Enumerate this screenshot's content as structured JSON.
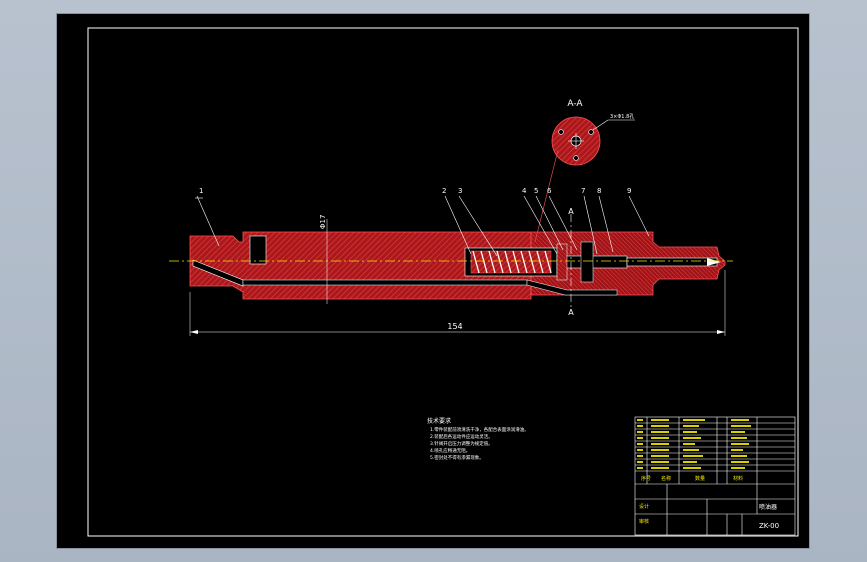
{
  "section": {
    "title": "A-A",
    "hole_note": "3×Φ1.8孔"
  },
  "callouts": [
    "1",
    "2",
    "3",
    "4",
    "5",
    "6",
    "7",
    "8",
    "9"
  ],
  "cut_marks": {
    "top": "A",
    "bottom": "A"
  },
  "dimensions": {
    "diameter": "Φ17",
    "length": "154"
  },
  "notes": {
    "heading": "技术要求",
    "lines": [
      "1.零件装配前须清洗干净，各配合表面涂润滑油。",
      "2.装配后各运动件应运动灵活。",
      "3.针阀开启压力调整为规定值。",
      "4.喷孔应畅通无阻。",
      "5.密封处不得有渗漏现象。"
    ]
  },
  "title_block": {
    "headers": [
      "序号",
      "名称",
      "数量",
      "材料"
    ],
    "part_name": "喷油器",
    "drawing_no": "ZK-00",
    "labels": {
      "design": "设计",
      "check": "审核"
    }
  },
  "colors": {
    "hatch": "#c8262a",
    "line_white": "#ffffff",
    "centerline": "#f2e600",
    "frame": "#ffffff"
  }
}
